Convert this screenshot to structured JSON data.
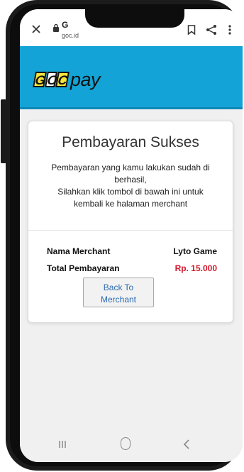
{
  "browser": {
    "tab_title": "G",
    "url": "goc.id"
  },
  "brand": {
    "logo_letters": [
      "G",
      "O",
      "C"
    ],
    "logo_word": "pay",
    "color": "#13a3d6"
  },
  "card": {
    "title": "Pembayaran Sukses",
    "message_lines": [
      "Pembayaran yang kamu lakukan sudah di",
      "berhasil,",
      "Silahkan klik tombol di bawah ini untuk",
      "kembali ke halaman merchant"
    ],
    "rows": [
      {
        "label": "Nama Merchant",
        "value": "Lyto Game"
      },
      {
        "label": "Total Pembayaran",
        "value": "Rp. 15.000"
      }
    ],
    "back_button": {
      "line1": "Back To",
      "line2": "Merchant"
    }
  },
  "colors": {
    "amount": "#d4152a",
    "button_text": "#2a6ab0"
  },
  "icons": {
    "close": "close-icon",
    "lock": "lock-icon",
    "bookmark": "bookmark-icon",
    "share": "share-icon",
    "menu": "more-vert-icon",
    "nav_recent": "recent-apps-icon",
    "nav_home": "home-icon",
    "nav_back": "back-icon"
  }
}
